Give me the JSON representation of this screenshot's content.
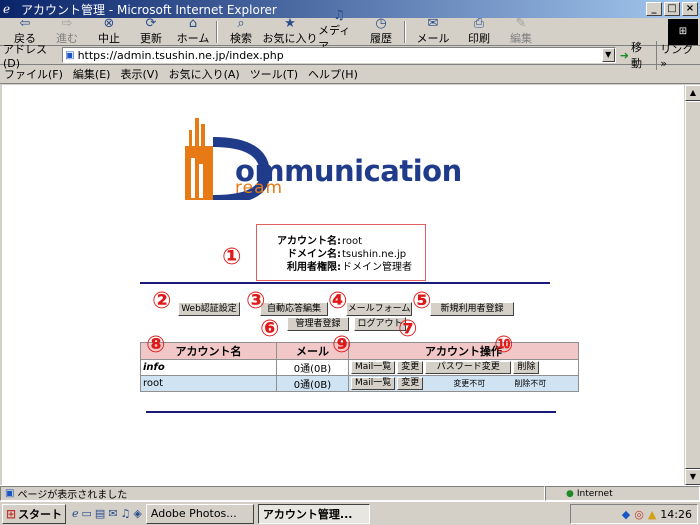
{
  "window": {
    "title": "アカウント管理 - Microsoft Internet Explorer",
    "controls": [
      "_",
      "□",
      "×"
    ]
  },
  "toolbar": {
    "items": [
      {
        "label": "戻る",
        "icon": "back-arrow-icon",
        "glyph": "⇦"
      },
      {
        "label": "進む",
        "icon": "forward-arrow-icon",
        "glyph": "⇨"
      },
      {
        "label": "中止",
        "icon": "stop-icon",
        "glyph": "⊗"
      },
      {
        "label": "更新",
        "icon": "refresh-icon",
        "glyph": "⟳"
      },
      {
        "label": "ホーム",
        "icon": "home-icon",
        "glyph": "⌂"
      },
      {
        "label": "検索",
        "icon": "search-icon",
        "glyph": "⌕"
      },
      {
        "label": "お気に入り",
        "icon": "favorites-icon",
        "glyph": "★"
      },
      {
        "label": "メディア",
        "icon": "media-icon",
        "glyph": "♫"
      },
      {
        "label": "履歴",
        "icon": "history-icon",
        "glyph": "◷"
      },
      {
        "label": "メール",
        "icon": "mail-icon",
        "glyph": "✉"
      },
      {
        "label": "印刷",
        "icon": "print-icon",
        "glyph": "⎙"
      },
      {
        "label": "編集",
        "icon": "edit-icon",
        "glyph": "✎"
      }
    ]
  },
  "address": {
    "label": "アドレス(D)",
    "url": "https://admin.tsushin.ne.jp/index.php",
    "go_label": "移動",
    "links_label": "リンク »"
  },
  "menu": {
    "items": [
      "ファイル(F)",
      "編集(E)",
      "表示(V)",
      "お気に入り(A)",
      "ツール(T)",
      "ヘルプ(H)"
    ]
  },
  "logo": {
    "main": "ommunication",
    "sub": "ream",
    "accent_orange": "#e87a15",
    "accent_blue": "#1f3b8a"
  },
  "info": {
    "account_label": "アカウント名:",
    "account_value": "root",
    "domain_label": "ドメイン名:",
    "domain_value": "tsushin.ne.jp",
    "privilege_label": "利用者権限:",
    "privilege_value": "ドメイン管理者"
  },
  "actions": {
    "web_auth": "Web認証設定",
    "auto_reply": "自動応答編集",
    "mail_form": "メールフォーム",
    "new_user": "新規利用者登録",
    "admin_register": "管理者登録",
    "logout": "ログアウト"
  },
  "markers": [
    "①",
    "②",
    "③",
    "④",
    "⑤",
    "⑥",
    "⑦",
    "⑧",
    "⑨",
    "⑩"
  ],
  "table": {
    "headers": {
      "name": "アカウント名",
      "mail": "メール",
      "ops": "アカウント操作"
    },
    "rows": [
      {
        "name": "info",
        "mail": "0通(0B)",
        "mail_list": "Mail一覧",
        "change": "変更",
        "password": "パスワード変更",
        "delete": "削除"
      },
      {
        "name": "root",
        "mail": "0通(0B)",
        "mail_list": "Mail一覧",
        "change": "変更",
        "password_note": "変更不可",
        "delete_note": "削除不可"
      }
    ]
  },
  "status": {
    "message": "ページが表示されました",
    "zone": "Internet"
  },
  "taskbar": {
    "start": "スタート",
    "tasks": [
      "Adobe Photos...",
      "アカウント管理..."
    ],
    "clock": "14:26"
  }
}
